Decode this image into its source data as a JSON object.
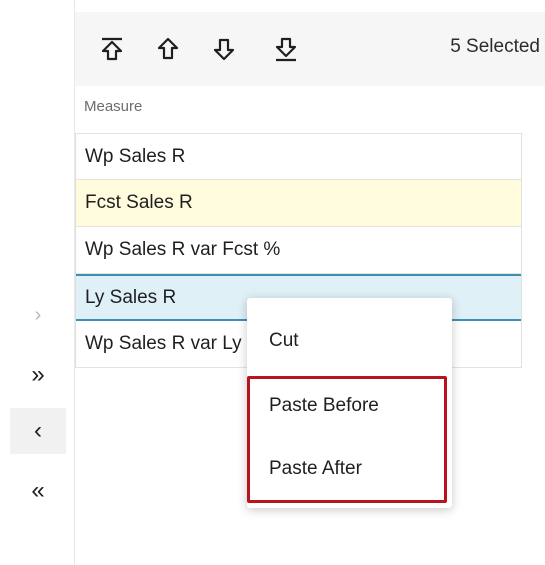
{
  "rail": {
    "items": [
      {
        "name": "chevron-right-icon",
        "glyph": "›",
        "state": "disabled"
      },
      {
        "name": "double-chevron-right-icon",
        "glyph": "»",
        "state": "normal"
      },
      {
        "name": "chevron-left-icon",
        "glyph": "‹",
        "state": "active"
      },
      {
        "name": "double-chevron-left-icon",
        "glyph": "«",
        "state": "normal"
      }
    ]
  },
  "toolbar": {
    "buttons": [
      {
        "name": "move-to-top-icon"
      },
      {
        "name": "move-up-icon"
      },
      {
        "name": "move-down-icon"
      },
      {
        "name": "move-to-bottom-icon"
      }
    ],
    "selected_count": "5 Selected"
  },
  "grid": {
    "column_header": "Measure",
    "rows": [
      {
        "label": "Wp Sales R",
        "state": "normal"
      },
      {
        "label": "Fcst Sales R",
        "state": "highlight"
      },
      {
        "label": "Wp Sales R var Fcst %",
        "state": "normal"
      },
      {
        "label": "Ly Sales R",
        "state": "selected"
      },
      {
        "label": "Wp Sales R var Ly",
        "state": "normal"
      }
    ]
  },
  "context_menu": {
    "items": [
      "Cut",
      "Paste Before",
      "Paste After"
    ],
    "highlight_color": "#b8141b"
  },
  "colors": {
    "selected_row_border": "#3d8fb3",
    "selected_row_bg": "#dff0f7",
    "highlight_row_bg": "#fffbdc"
  }
}
